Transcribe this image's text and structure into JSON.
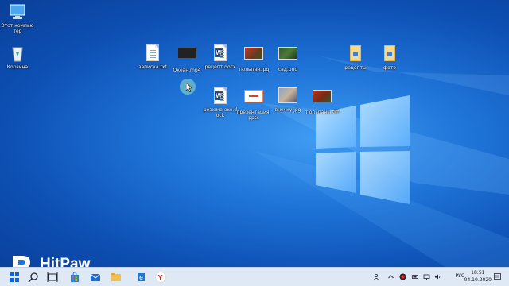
{
  "desktop": {
    "icons": [
      {
        "label": "Этот компьютер",
        "kind": "pc-icon"
      },
      {
        "label": "Корзина",
        "kind": "recycle-bin-icon"
      },
      {
        "label": "записка.txt",
        "kind": "text-file-icon"
      },
      {
        "label": "Океан.mp4",
        "kind": "video-file-icon"
      },
      {
        "label": "рецепт.docx",
        "kind": "word-file-icon"
      },
      {
        "label": "тюльпан.jpg",
        "kind": "image-file-icon"
      },
      {
        "label": "сад.png",
        "kind": "image-file-icon"
      },
      {
        "label": "рецепты",
        "kind": "folder-icon"
      },
      {
        "label": "фото",
        "kind": "folder-icon"
      },
      {
        "label": "резюме exe.dock",
        "kind": "word-file-icon"
      },
      {
        "label": "презентация.pptx",
        "kind": "presentation-file-icon"
      },
      {
        "label": "внучку.jpg",
        "kind": "image-file-icon"
      },
      {
        "label": "тюльпаны.tiff",
        "kind": "image-file-icon"
      }
    ]
  },
  "watermark": {
    "text": "HitPaw"
  },
  "taskbar": {
    "apps": [
      "start-icon",
      "search-icon",
      "task-view-icon",
      "store-icon",
      "mail-icon",
      "file-explorer-icon",
      "edge-icon",
      "yandex-browser-icon"
    ],
    "tray": {
      "language": "РУС",
      "time": "18:51",
      "date": "04.10.2020"
    }
  },
  "colors": {
    "desktop": "#1f74d8",
    "taskbar": "#dfe8f5",
    "word": "#2b579a"
  }
}
